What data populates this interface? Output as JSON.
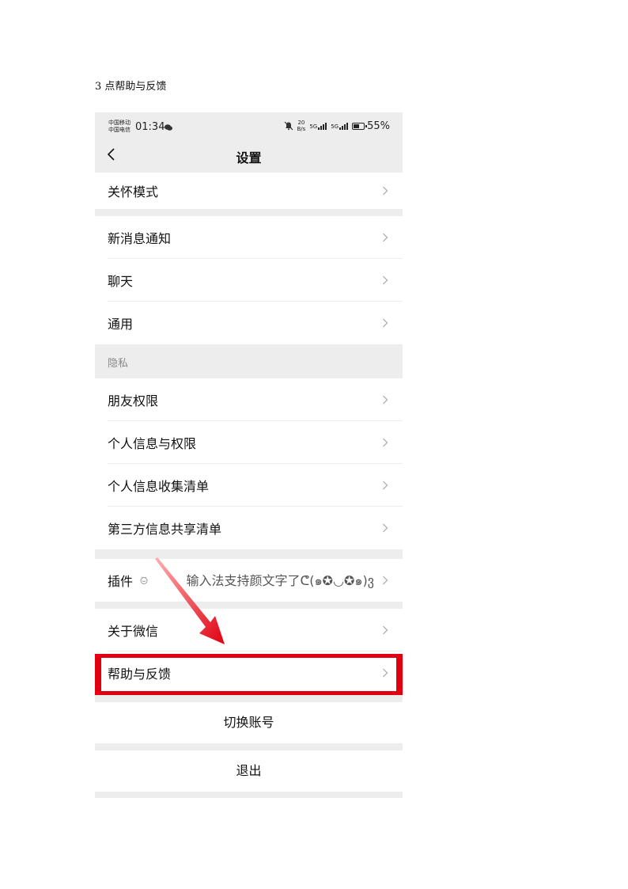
{
  "caption": "3 点帮助与反馈",
  "status_bar": {
    "carrier_1": "中国移动",
    "carrier_2": "中国电信",
    "time": "01:34",
    "net_speed_value": "20",
    "net_speed_unit": "B/s",
    "signal_1": "5G",
    "signal_2": "5G",
    "battery": "55%"
  },
  "navbar": {
    "title": "设置"
  },
  "groups": {
    "care": {
      "label": "关怀模式"
    },
    "g2": [
      "新消息通知",
      "聊天",
      "通用"
    ],
    "privacy_header": "隐私",
    "g3": [
      "朋友权限",
      "个人信息与权限",
      "个人信息收集清单",
      "第三方信息共享清单"
    ],
    "plugins": {
      "label": "插件",
      "value": "输入法支持颜文字了ᕦ(๑✪◡✪๑)ვ"
    },
    "g5": [
      "关于微信",
      "帮助与反馈"
    ]
  },
  "actions": {
    "switch_account": "切换账号",
    "logout": "退出"
  },
  "colors": {
    "highlight": "#e00010",
    "background": "#ededed"
  }
}
